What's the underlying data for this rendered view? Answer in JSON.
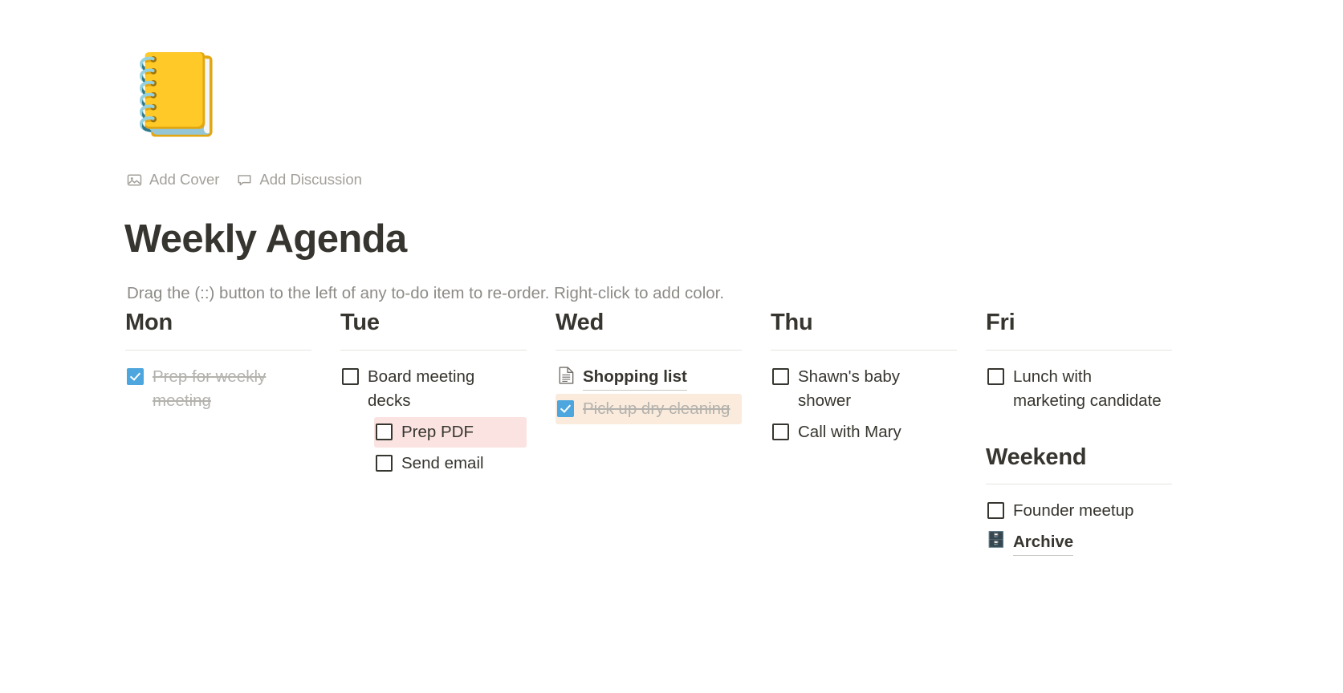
{
  "page": {
    "emoji": "📒",
    "emoji_name": "ledger-notebook",
    "title": "Weekly Agenda",
    "description": "Drag the (::) button to the left of any to-do item to re-order. Right-click to add color."
  },
  "meta_actions": [
    {
      "label": "Add Cover",
      "icon": "image-icon"
    },
    {
      "label": "Add Discussion",
      "icon": "comment-icon"
    }
  ],
  "colors": {
    "checked_checkbox": "#4da6dd",
    "highlight_red": "#fae3e1",
    "highlight_tan": "#faebdd",
    "text_primary": "#37352f",
    "text_muted": "#8d8b86",
    "text_done": "#b4b2ad",
    "rule": "#e6e4e0"
  },
  "columns": [
    {
      "heading": "Mon",
      "items": [
        {
          "type": "todo",
          "label": "Prep for weekly meeting",
          "checked": true,
          "indent": false,
          "highlight": "none"
        }
      ]
    },
    {
      "heading": "Tue",
      "items": [
        {
          "type": "todo",
          "label": "Board meeting decks",
          "checked": false,
          "indent": false,
          "highlight": "none"
        },
        {
          "type": "todo",
          "label": "Prep PDF",
          "checked": false,
          "indent": true,
          "highlight": "red"
        },
        {
          "type": "todo",
          "label": "Send email",
          "checked": false,
          "indent": true,
          "highlight": "none"
        }
      ]
    },
    {
      "heading": "Wed",
      "items": [
        {
          "type": "page-link",
          "label": "Shopping list",
          "icon": "document-icon",
          "emoji": ""
        },
        {
          "type": "todo",
          "label": "Pick up dry cleaning",
          "checked": true,
          "indent": false,
          "highlight": "tan"
        }
      ]
    },
    {
      "heading": "Thu",
      "items": [
        {
          "type": "todo",
          "label": "Shawn's baby shower",
          "checked": false,
          "indent": false,
          "highlight": "none"
        },
        {
          "type": "todo",
          "label": "Call with Mary",
          "checked": false,
          "indent": false,
          "highlight": "none"
        }
      ]
    },
    {
      "heading": "Fri",
      "items": [
        {
          "type": "todo",
          "label": "Lunch with marketing candidate",
          "checked": false,
          "indent": false,
          "highlight": "none"
        }
      ],
      "sub_heading": "Weekend",
      "sub_items": [
        {
          "type": "todo",
          "label": "Founder meetup",
          "checked": false,
          "indent": false,
          "highlight": "none"
        },
        {
          "type": "page-link",
          "label": "Archive",
          "icon": "file-cabinet-icon",
          "emoji": "🗄️"
        }
      ]
    }
  ]
}
